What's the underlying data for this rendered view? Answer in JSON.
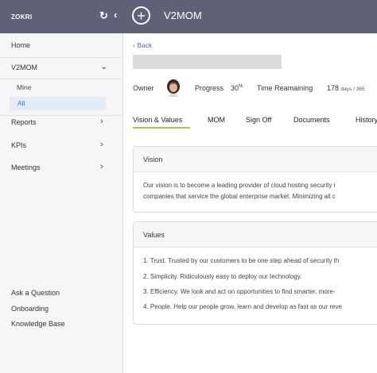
{
  "topbar": {
    "brand": "ZOKRI",
    "app_title": "V2MOM"
  },
  "sidebar": {
    "home": "Home",
    "v2mom": "V2MOM",
    "sub_items": [
      "Mine",
      "All"
    ],
    "reports": "Reports",
    "kpis": "KPIs",
    "meetings": "Meetings",
    "footer": [
      "Ask a Question",
      "Onboarding",
      "Knowledge Base"
    ]
  },
  "main": {
    "back": "Back",
    "owner_label": "Owner",
    "progress_label": "Progress",
    "progress_value": "30",
    "progress_unit": "%",
    "time_label": "Time Reamaining",
    "time_value": "178",
    "time_unit": "days / 365",
    "tabs": [
      "Vision & Values",
      "MOM",
      "Sign Off",
      "Documents",
      "History"
    ],
    "vision": {
      "heading": "Vision",
      "lines": [
        "Our vision is to become a leading provider of cloud hosting security i",
        "companies that service the global enterprise market. Minimizing all c"
      ]
    },
    "values": {
      "heading": "Values",
      "lines": [
        "1. Trust. Trusted by our customers to be one step ahead of security th",
        "2. Simplicity. Ridiculously easy to deploy our technology.",
        "3. Efficiency. We look and act on opportunities to find smarter, more-",
        "4. People. Help our people grow, learn and develop as fast as our reve"
      ]
    }
  }
}
